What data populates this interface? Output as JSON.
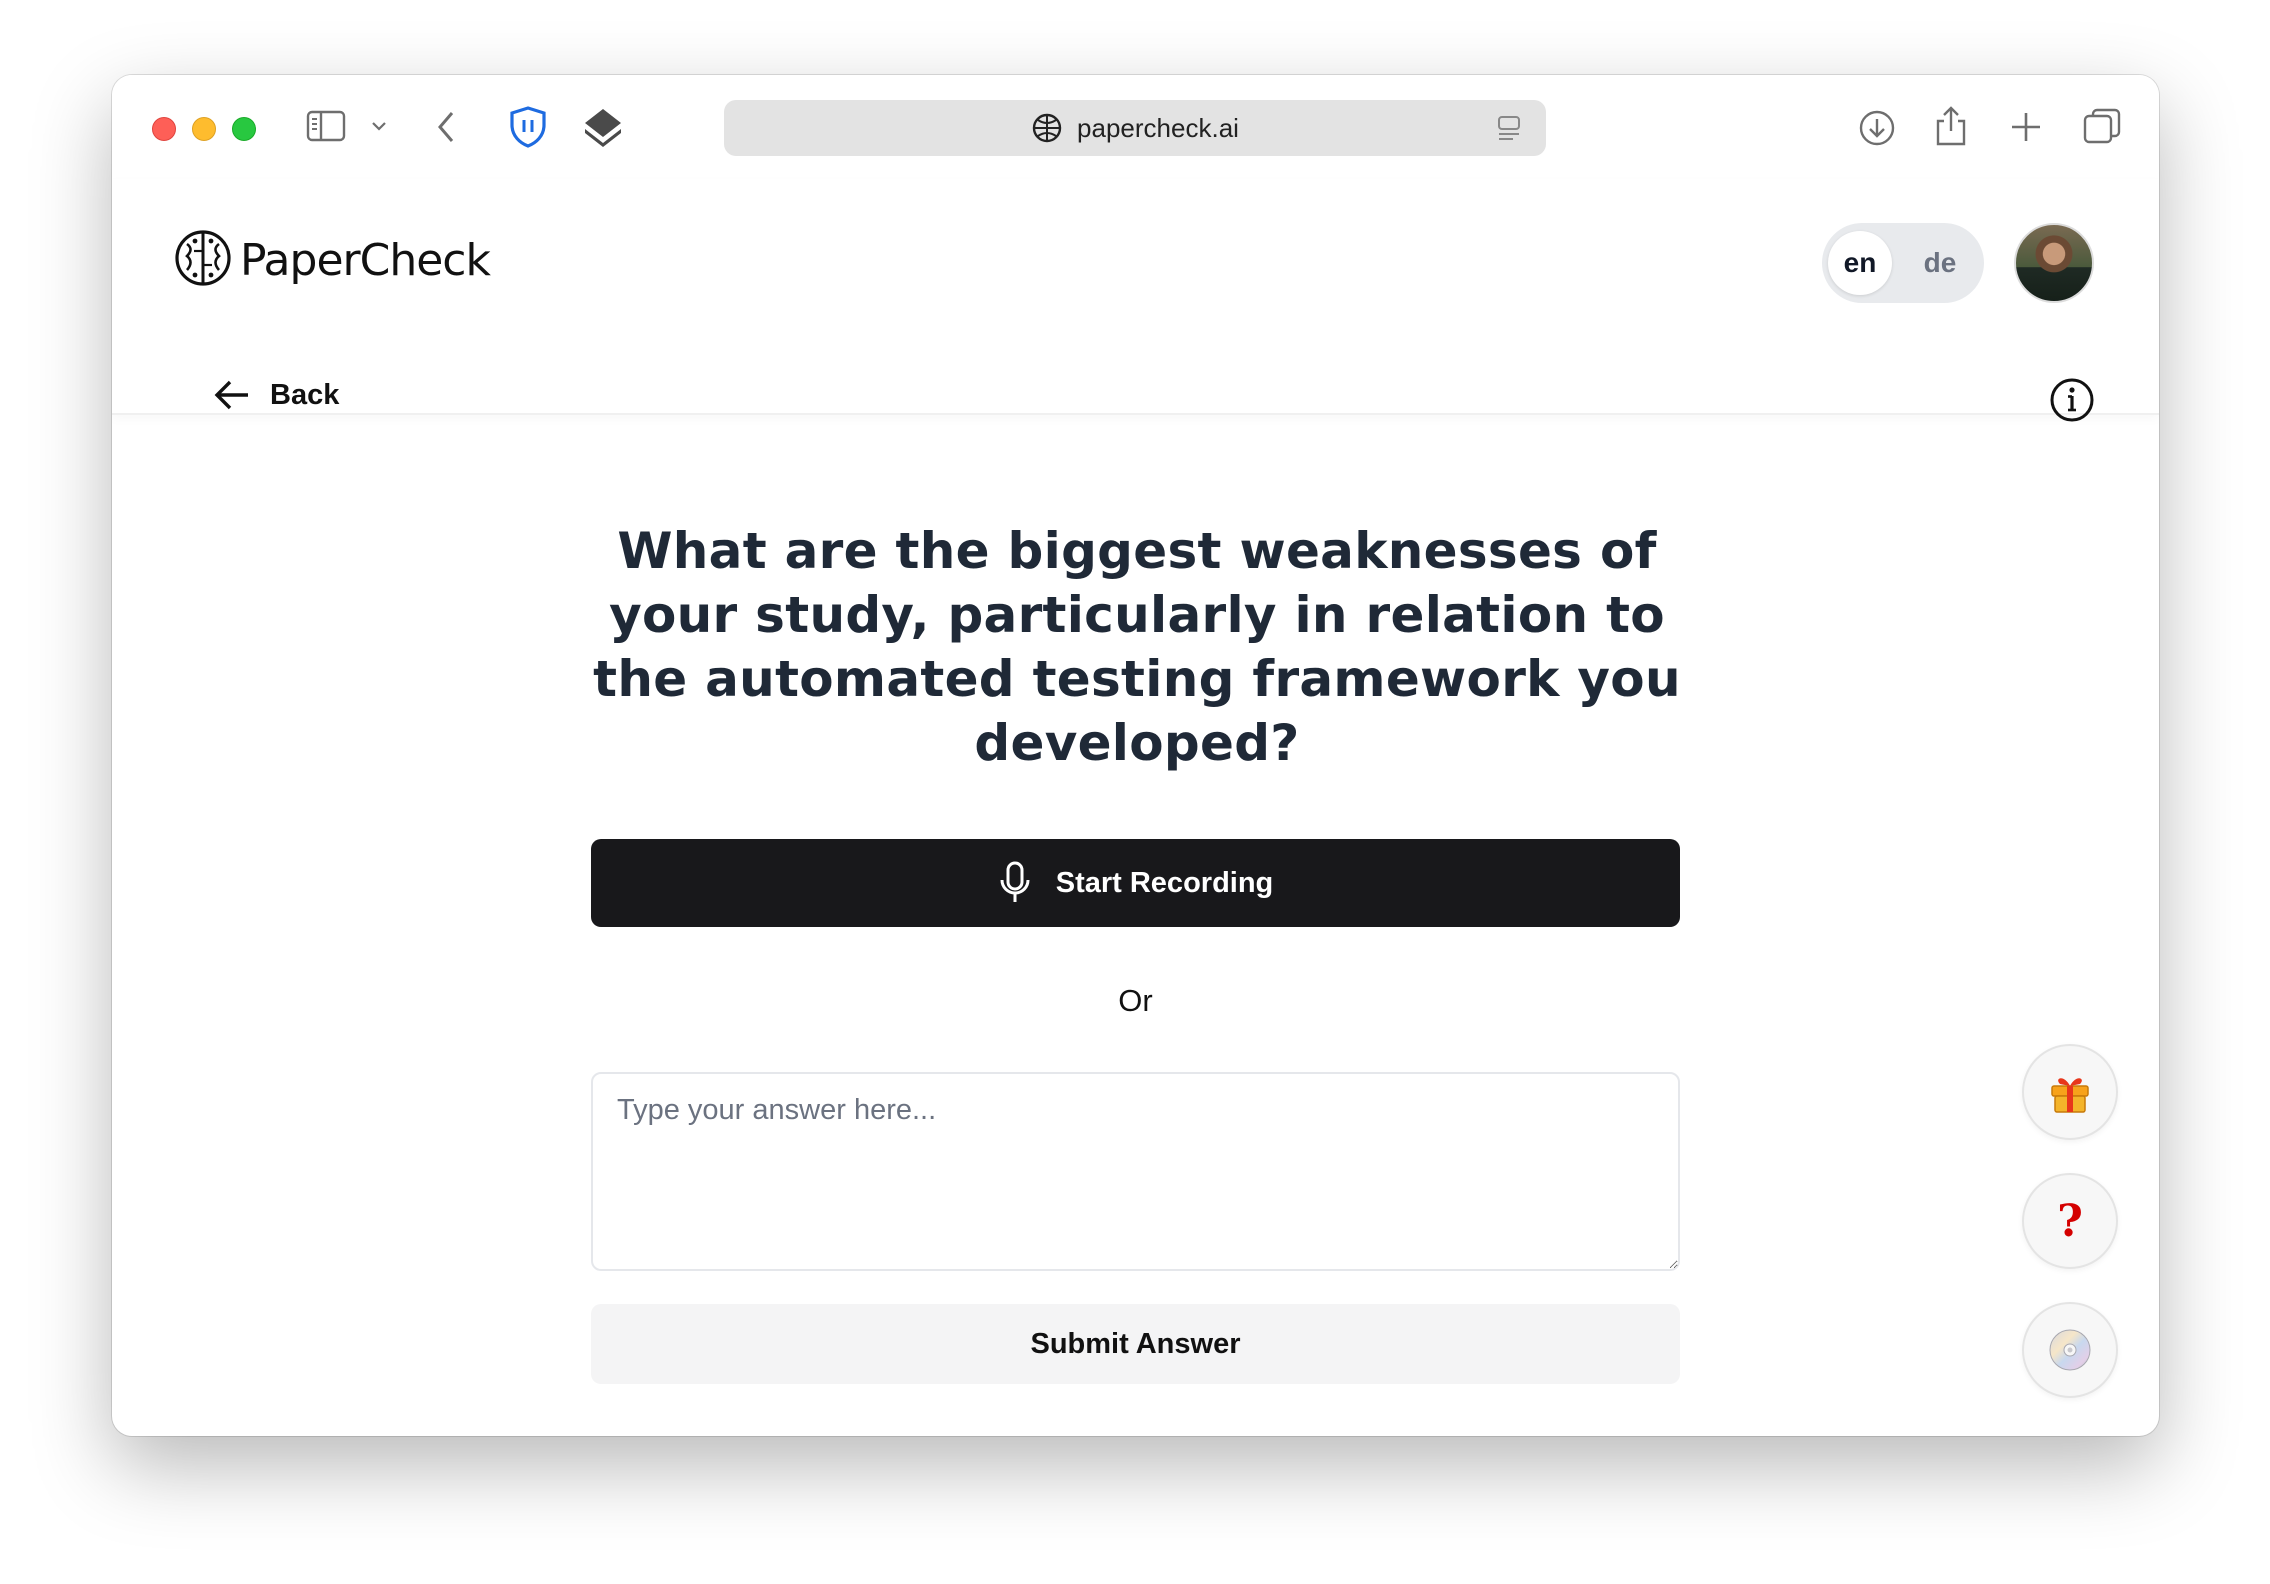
{
  "browser": {
    "url": "papercheck.ai"
  },
  "header": {
    "logo_text": "PaperCheck",
    "languages": [
      {
        "code": "en",
        "active": true
      },
      {
        "code": "de",
        "active": false
      }
    ]
  },
  "nav": {
    "back_label": "Back"
  },
  "question": {
    "text": "What are the biggest weaknesses of your study, particularly in relation to the automated testing framework you developed?"
  },
  "actions": {
    "record_label": "Start Recording",
    "or_label": "Or",
    "answer_placeholder": "Type your answer here...",
    "answer_value": "",
    "submit_label": "Submit Answer"
  },
  "floating_buttons": [
    {
      "icon": "gift-icon"
    },
    {
      "icon": "question-mark-icon",
      "label": "?"
    },
    {
      "icon": "disc-icon"
    }
  ],
  "colors": {
    "primary_button": "#18181b",
    "secondary_button": "#f4f4f5",
    "heading": "#1f2937",
    "help_mark": "#d40000"
  }
}
